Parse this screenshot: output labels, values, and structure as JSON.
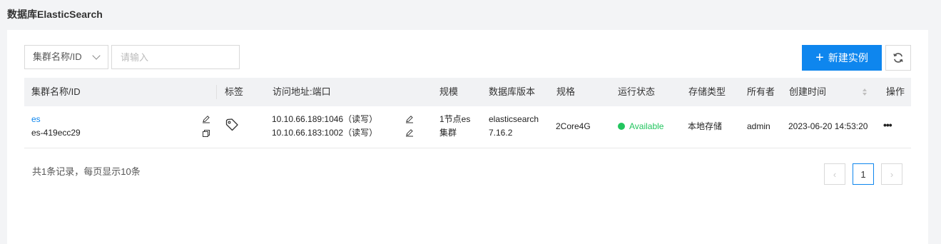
{
  "page": {
    "title": "数据库ElasticSearch"
  },
  "toolbar": {
    "filter_select_value": "集群名称/ID",
    "search_placeholder": "请输入",
    "new_instance_label": "新建实例",
    "refresh_icon": "refresh-icon",
    "accent_color": "#0e86ee"
  },
  "table": {
    "columns": [
      "集群名称/ID",
      "标签",
      "访问地址:端口",
      "规模",
      "数据库版本",
      "规格",
      "运行状态",
      "存储类型",
      "所有者",
      "创建时间",
      "操作"
    ],
    "rows": [
      {
        "name": "es",
        "id": "es-419ecc29",
        "address_1": "10.10.66.189:1046（读写）",
        "address_2": "10.10.66.183:1002（读写）",
        "scale_line1": "1节点es",
        "scale_line2": "集群",
        "version_line1": "elasticsearch",
        "version_line2": "7.16.2",
        "spec": "2Core4G",
        "status": "Available",
        "status_color": "#22c55e",
        "storage": "本地存储",
        "owner": "admin",
        "created": "2023-06-20 14:53:20",
        "actions": "•••"
      }
    ]
  },
  "footer": {
    "summary": "共1条记录，每页显示10条",
    "current_page": "1",
    "prev": "‹",
    "next": "›"
  }
}
